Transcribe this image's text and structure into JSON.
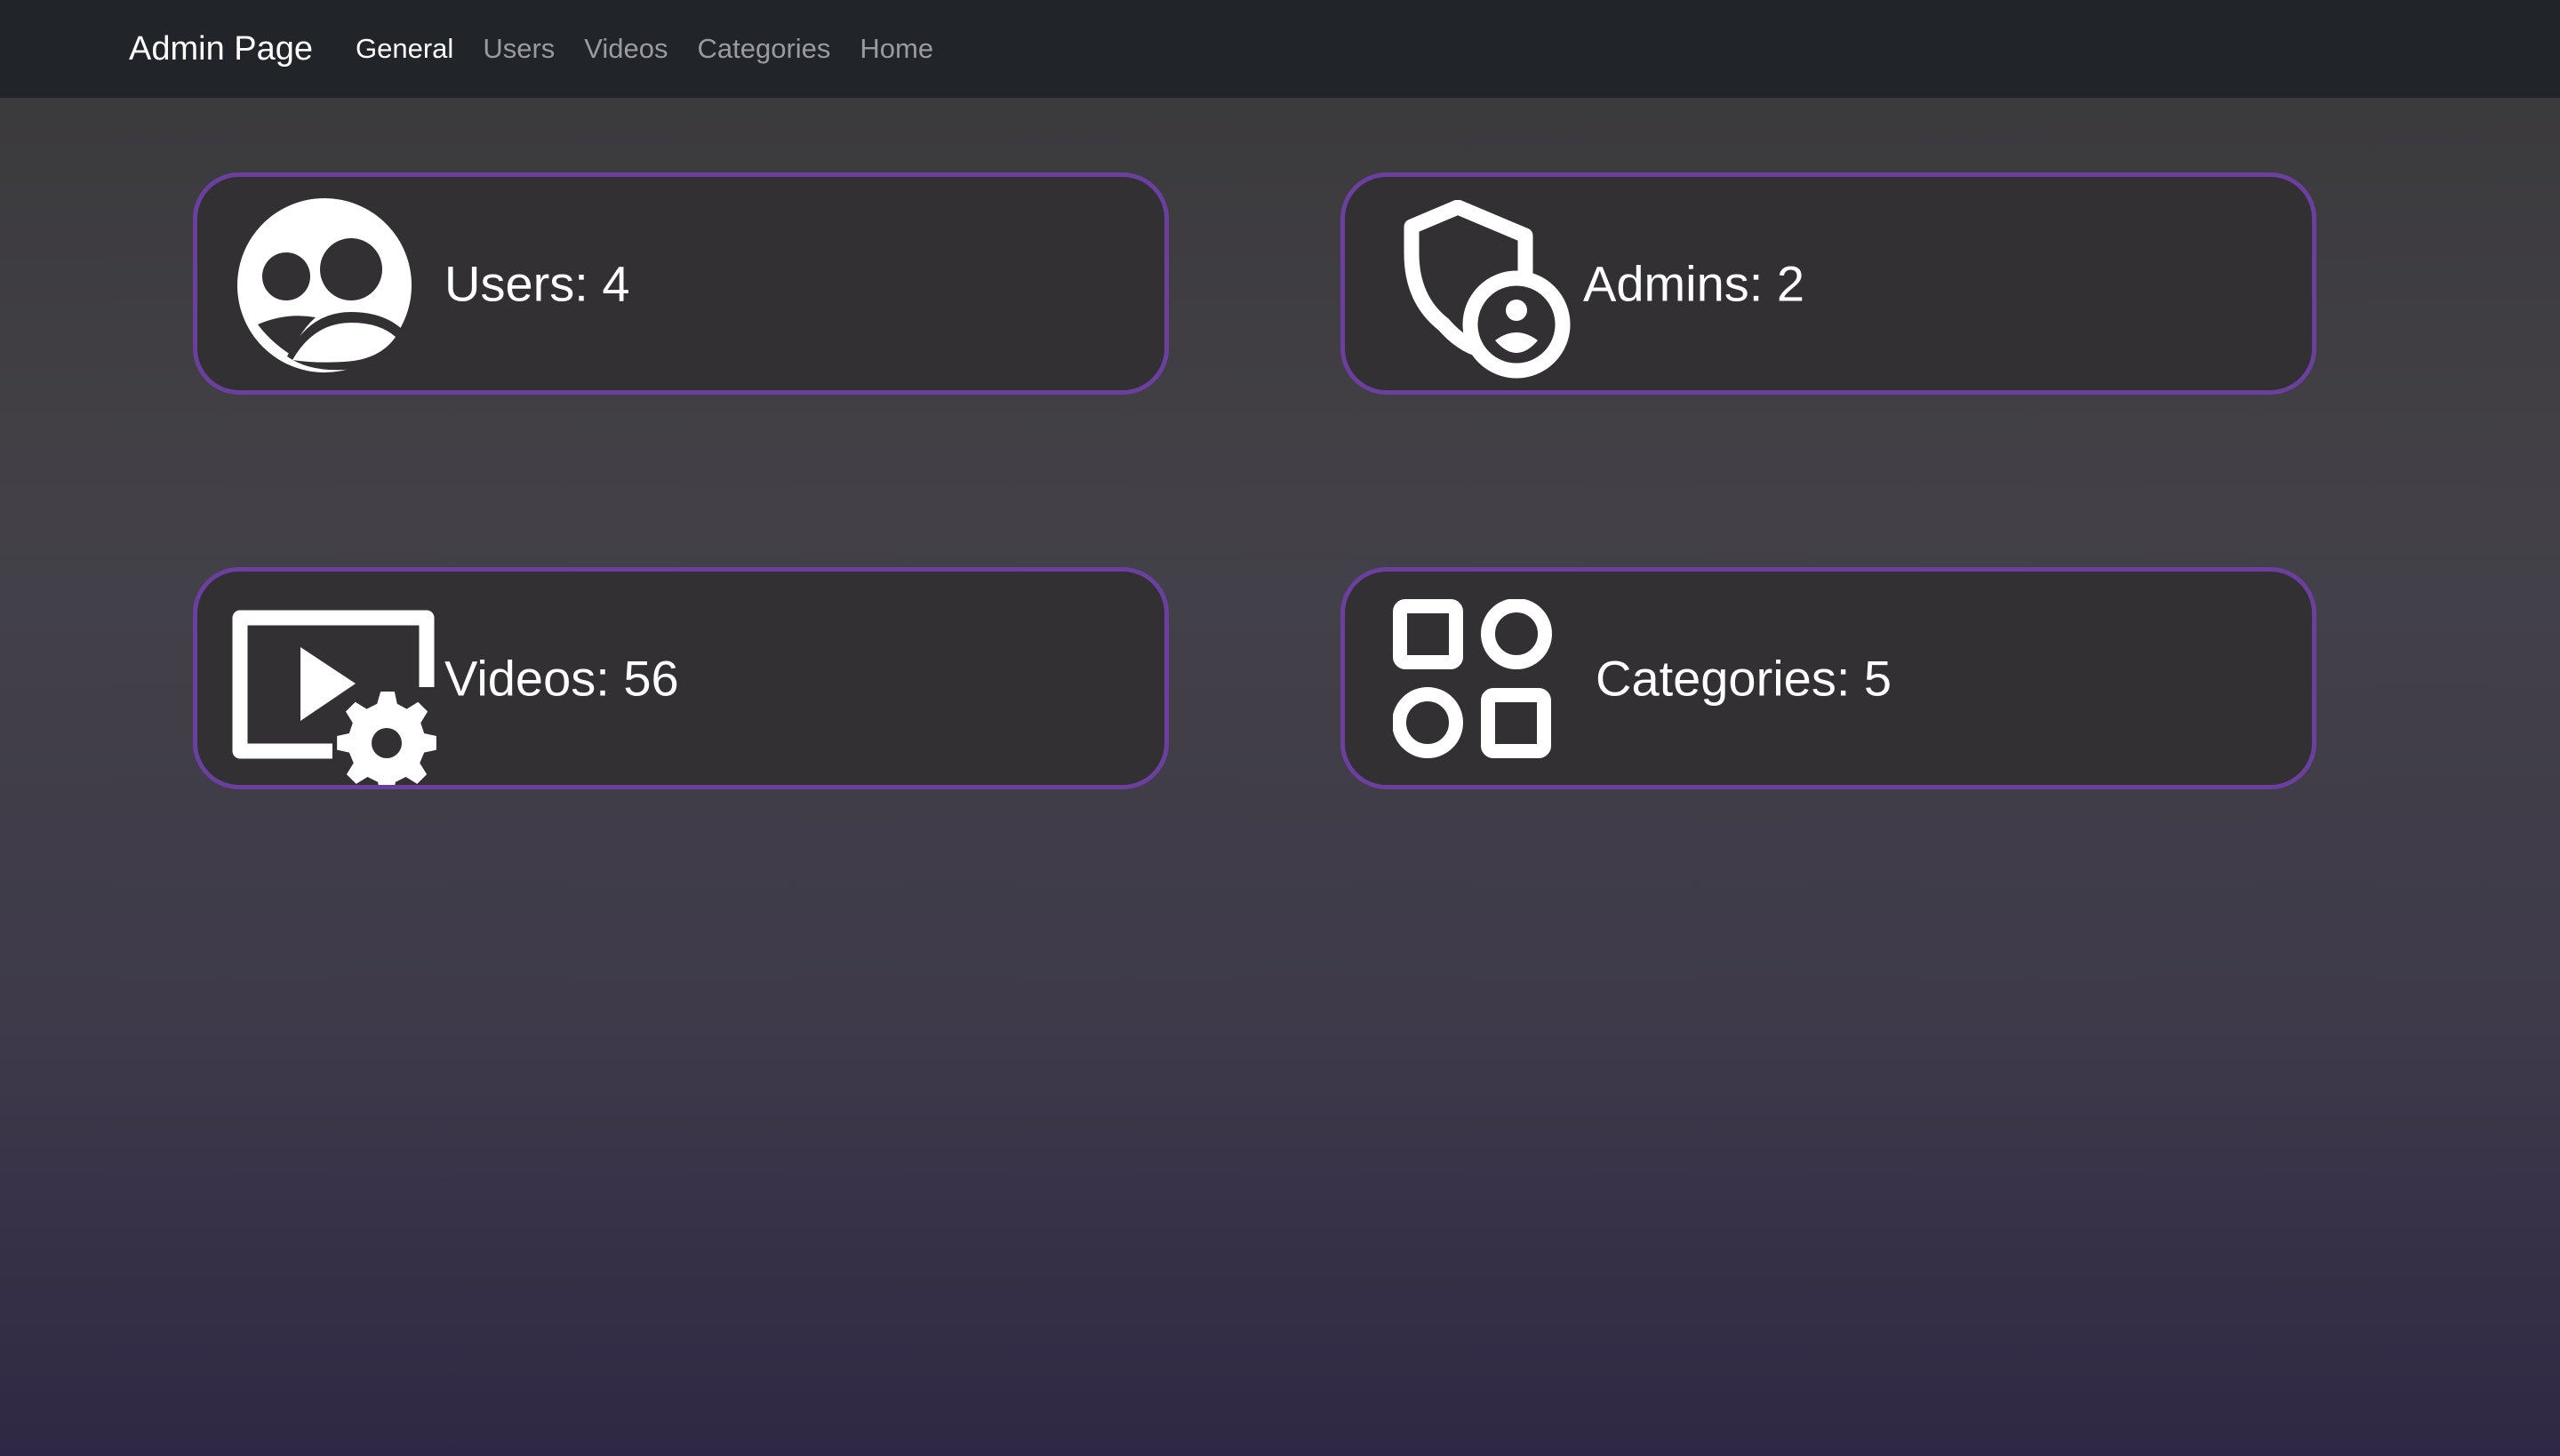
{
  "navbar": {
    "brand": "Admin Page",
    "links": [
      {
        "label": "General",
        "active": true
      },
      {
        "label": "Users",
        "active": false
      },
      {
        "label": "Videos",
        "active": false
      },
      {
        "label": "Categories",
        "active": false
      },
      {
        "label": "Home",
        "active": false
      }
    ]
  },
  "cards": {
    "users": {
      "label": "Users: 4",
      "icon": "people-circle-icon"
    },
    "admins": {
      "label": "Admins: 2",
      "icon": "shield-person-icon"
    },
    "videos": {
      "label": "Videos: 56",
      "icon": "video-settings-icon"
    },
    "categories": {
      "label": "Categories: 5",
      "icon": "apps-shapes-icon"
    }
  },
  "colors": {
    "navbar_bg": "#212429",
    "card_border": "#6b3f9e",
    "card_bg": "#333034",
    "text": "#ffffff",
    "nav_inactive": "#9a9b9e"
  }
}
